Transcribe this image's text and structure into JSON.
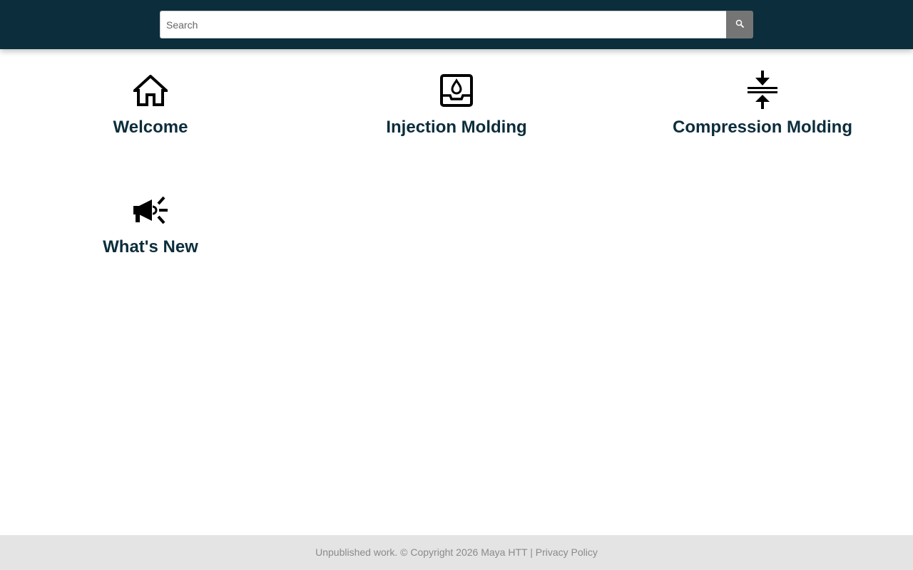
{
  "search": {
    "placeholder": "Search",
    "button_icon": "search-icon"
  },
  "tiles": [
    {
      "label": "Welcome",
      "icon": "home-icon"
    },
    {
      "label": "Injection Molding",
      "icon": "tray-droplet-icon"
    },
    {
      "label": "Compression Molding",
      "icon": "compress-arrows-icon"
    },
    {
      "label": "What's New",
      "icon": "megaphone-icon"
    }
  ],
  "footer": {
    "notice": "Unpublished work. © Copyright 2026 Maya HTT",
    "separator": " | ",
    "privacy_link": "Privacy Policy"
  },
  "colors": {
    "header_bg": "#0c2d3c",
    "tile_label": "#0c2d3c",
    "footer_bg": "#e4e4e4",
    "search_button_bg": "#757575"
  }
}
